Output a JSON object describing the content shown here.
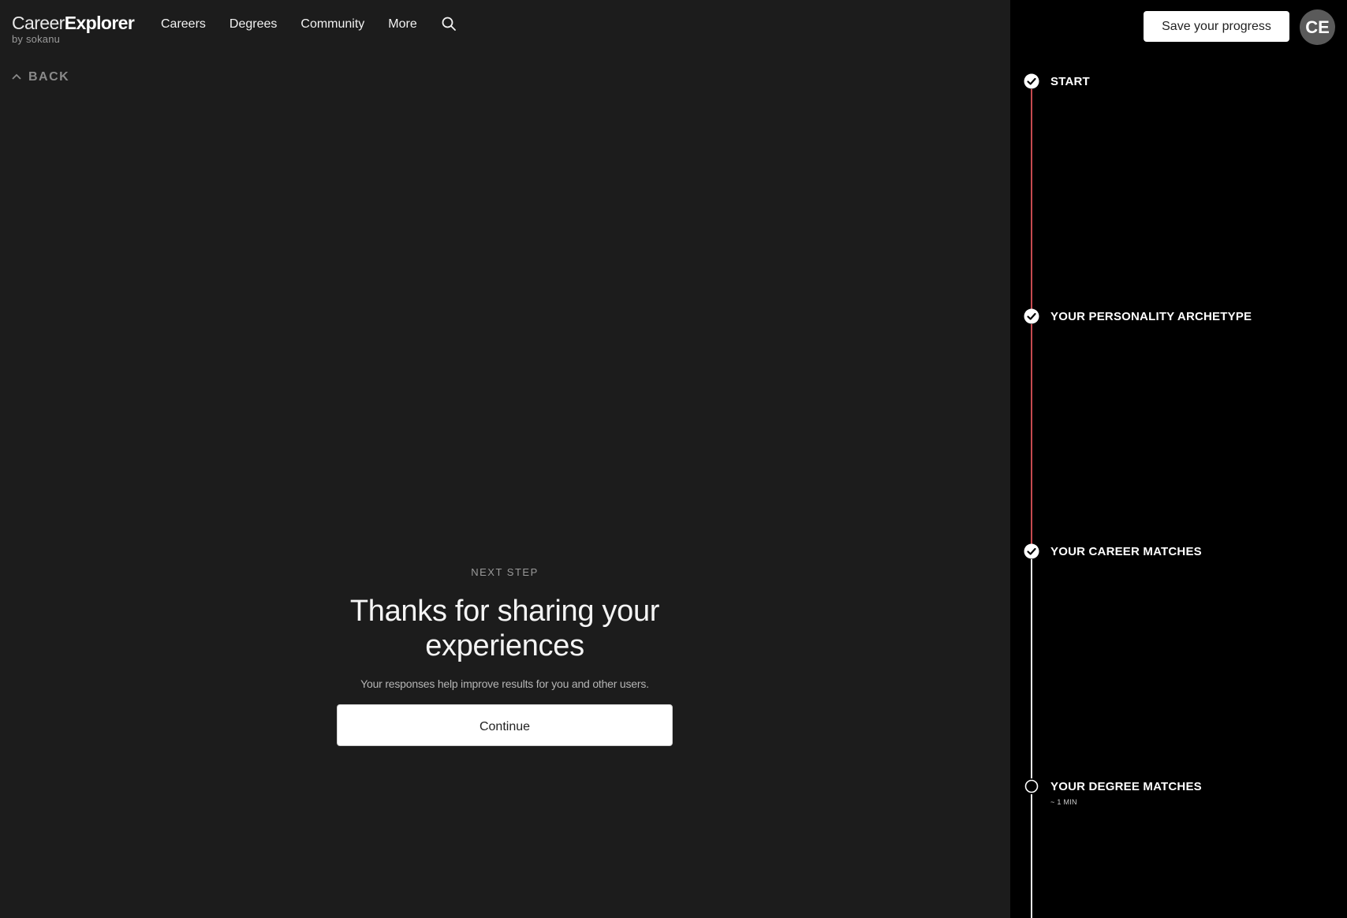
{
  "logo": {
    "main_light": "Career",
    "main_bold": "Explorer",
    "sub": "by sokanu"
  },
  "nav": {
    "items": [
      "Careers",
      "Degrees",
      "Community",
      "More"
    ]
  },
  "back": {
    "label": "BACK"
  },
  "main": {
    "eyebrow": "NEXT STEP",
    "title": "Thanks for sharing your experiences",
    "subtitle": "Your responses help improve results for you and other users.",
    "continue_label": "Continue"
  },
  "sidebar": {
    "save_label": "Save your progress",
    "avatar_initials": "CE",
    "steps": [
      {
        "label": "START",
        "status": "complete"
      },
      {
        "label": "YOUR PERSONALITY ARCHETYPE",
        "status": "complete"
      },
      {
        "label": "YOUR CAREER MATCHES",
        "status": "complete"
      },
      {
        "label": "YOUR DEGREE MATCHES",
        "status": "current",
        "meta": "~ 1 MIN"
      }
    ]
  },
  "colors": {
    "left_bg": "#1c1c1c",
    "right_bg": "#000000",
    "progress_line": "#c64a4f",
    "upcoming_line": "#e6e6e6"
  }
}
